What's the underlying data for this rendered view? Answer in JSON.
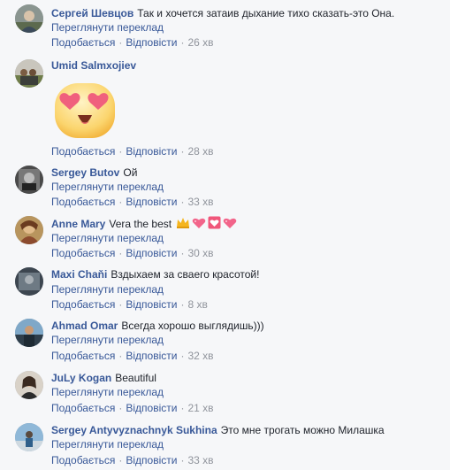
{
  "actions": {
    "like": "Подобається",
    "reply": "Відповісти",
    "translate": "Переглянути переклад"
  },
  "comments": [
    {
      "author": "Сергей Шевцов",
      "text": "Так и хочется затаив дыхание тихо сказать-это Она.",
      "time": "26 хв"
    },
    {
      "author": "Umid Salmxojiev",
      "text": "",
      "time": "28 хв"
    },
    {
      "author": "Sergey Butov",
      "text": "Ой",
      "time": "33 хв"
    },
    {
      "author": "Anne Mary",
      "text": "Vera the best",
      "time": "30 хв"
    },
    {
      "author": "Maxi Chaňi",
      "text": "Вздыхаем за сваего красотой!",
      "time": "8 хв"
    },
    {
      "author": "Ahmad Omar",
      "text": "Всегда хорошо выглядишь)))",
      "time": "32 хв"
    },
    {
      "author": "JuLy Kogan",
      "text": "Beautiful",
      "time": "21 хв"
    },
    {
      "author": "Sergey Antyvyznachnyk Sukhina",
      "text": "Это мне трогать можно Милашка",
      "time": "33 хв"
    }
  ],
  "colors": {
    "link": "#385898",
    "meta": "#90949c",
    "background": "#f6f7f9"
  },
  "icons": {
    "sticker": "heart-eyes-emoji",
    "anne_emojis": [
      "crown-emoji",
      "sparkling-heart-emoji",
      "heart-box-emoji",
      "sparkling-heart-emoji"
    ]
  }
}
